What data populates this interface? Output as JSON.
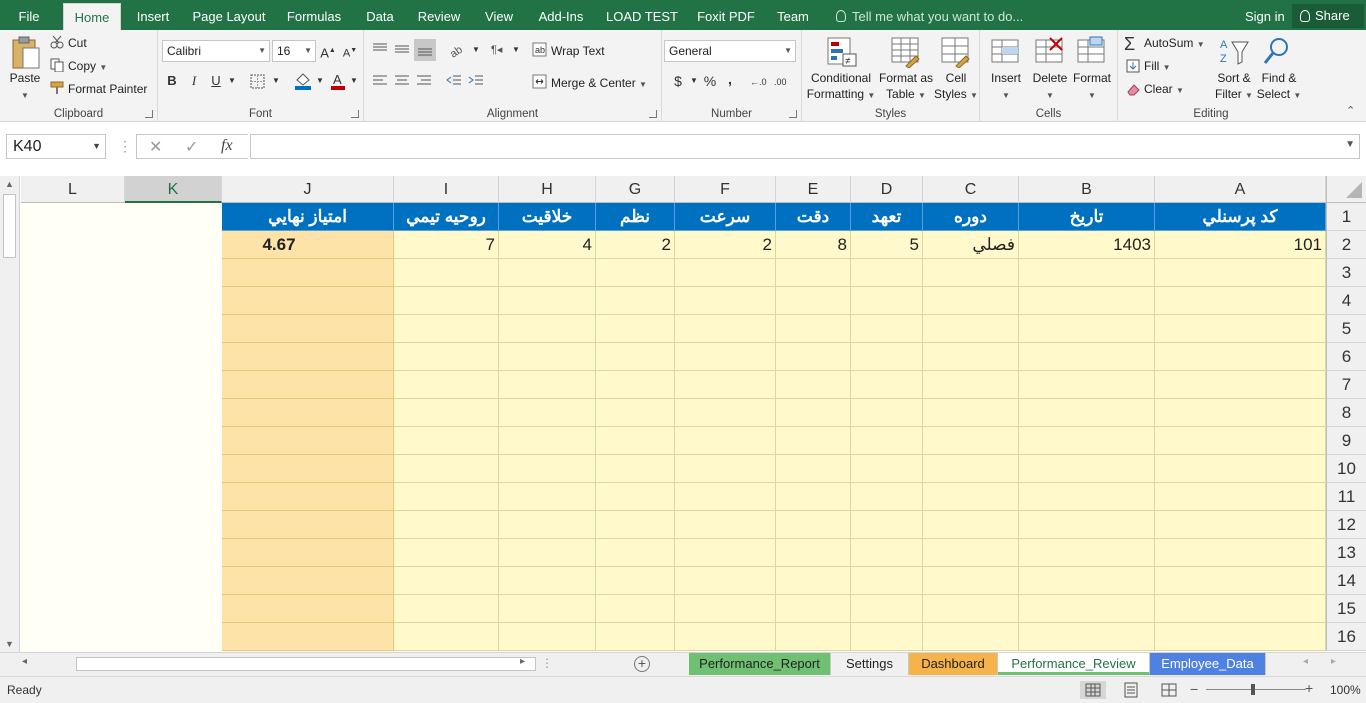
{
  "ribbon_tabs": [
    "File",
    "Home",
    "Insert",
    "Page Layout",
    "Formulas",
    "Data",
    "Review",
    "View",
    "Add-Ins",
    "LOAD TEST",
    "Foxit PDF",
    "Team"
  ],
  "tell_me": "Tell me what you want to do...",
  "sign_in": "Sign in",
  "share": "Share",
  "clipboard": {
    "paste": "Paste",
    "cut": "Cut",
    "copy": "Copy",
    "format_painter": "Format Painter",
    "label": "Clipboard"
  },
  "font": {
    "name": "Calibri",
    "size": "16",
    "label": "Font",
    "bold": "B",
    "italic": "I",
    "underline": "U"
  },
  "alignment": {
    "wrap_text": "Wrap Text",
    "merge_center": "Merge & Center",
    "label": "Alignment"
  },
  "number": {
    "format": "General",
    "label": "Number",
    "currency": "$",
    "percent": "%",
    "comma": ","
  },
  "styles": {
    "conditional": "Conditional",
    "formatting": "Formatting",
    "format_as": "Format as",
    "table": "Table",
    "cell": "Cell",
    "cell_styles": "Styles",
    "label": "Styles"
  },
  "cells": {
    "insert": "Insert",
    "delete": "Delete",
    "format": "Format",
    "label": "Cells"
  },
  "editing": {
    "autosum": "AutoSum",
    "fill": "Fill",
    "clear": "Clear",
    "sort": "Sort &",
    "filter": "Filter",
    "find": "Find &",
    "select": "Select",
    "label": "Editing"
  },
  "formula_bar": {
    "name_box": "K40",
    "cancel": "✕",
    "enter": "✓",
    "fx": "fx",
    "content": ""
  },
  "columns": [
    "L",
    "K",
    "J",
    "I",
    "H",
    "G",
    "F",
    "E",
    "D",
    "C",
    "B",
    "A"
  ],
  "rows": [
    "1",
    "2",
    "3",
    "4",
    "5",
    "6",
    "7",
    "8",
    "9",
    "10",
    "11",
    "12",
    "13",
    "14",
    "15",
    "16"
  ],
  "headers": {
    "A": "كد پرسنلي",
    "B": "تاريخ",
    "C": "دوره",
    "D": "تعهد",
    "E": "دقت",
    "F": "سرعت",
    "G": "نظم",
    "H": "خلاقيت",
    "I": "روحيه تيمي",
    "J": "امتياز نهايي"
  },
  "row2": {
    "A": "101",
    "B": "1403",
    "C": "فصلي",
    "D": "5",
    "E": "8",
    "F": "2",
    "G": "2",
    "H": "4",
    "I": "7",
    "J": "4.67"
  },
  "sheets": [
    "Performance_Report",
    "Settings",
    "Dashboard",
    "Performance_Review",
    "Employee_Data"
  ],
  "status": {
    "ready": "Ready",
    "zoom": "100%"
  },
  "colors": {
    "excel_green": "#217346",
    "header_blue": "#0070c0",
    "cell_yellow": "#fff9cc",
    "col_j_orange": "#fde3a7"
  }
}
